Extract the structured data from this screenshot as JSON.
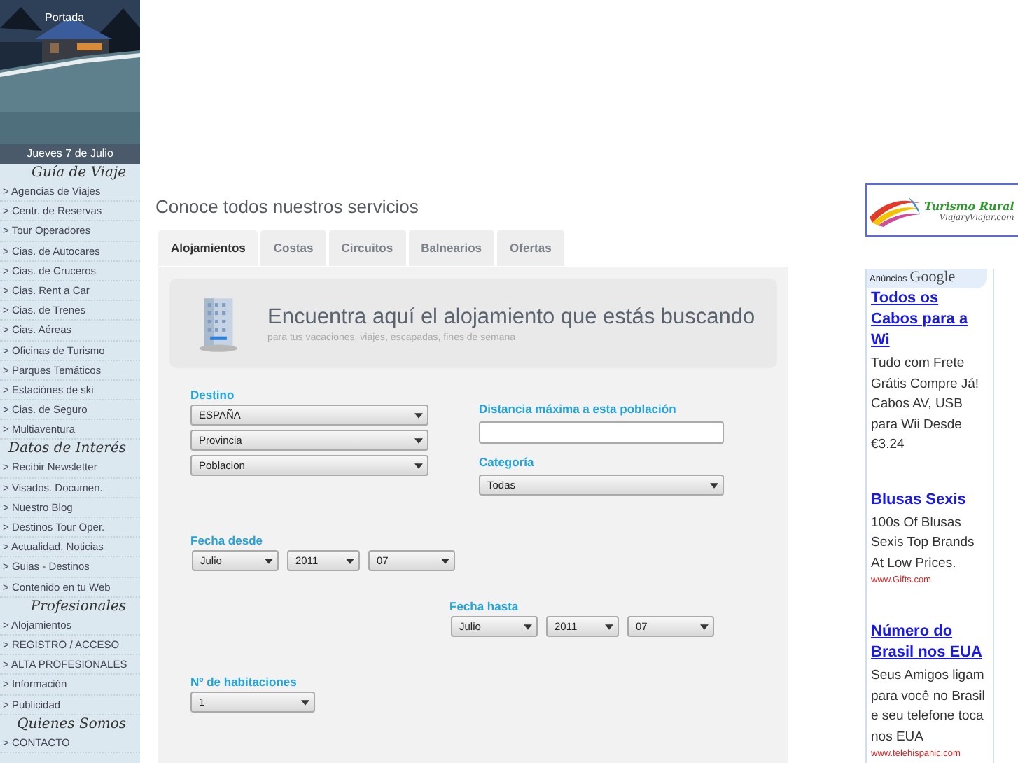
{
  "sidebar": {
    "photo_label": "Portada",
    "date": "Jueves 7 de Julio",
    "sections": [
      {
        "title": "Guía de Viaje",
        "items": [
          "> Agencias de Viajes",
          "> Centr. de Reservas",
          "> Tour Operadores",
          "> Cias. de Autocares",
          "> Cias. de Cruceros",
          "> Cias. Rent a Car",
          "> Cias. de Trenes",
          "> Cias. Aéreas",
          "> Oficinas de Turismo",
          "> Parques Temáticos",
          "> Estaciónes de ski",
          "> Cias. de Seguro",
          "> Multiaventura"
        ]
      },
      {
        "title": "Datos de Interés",
        "items": [
          "> Recibir Newsletter",
          "> Visados. Documen.",
          "> Nuestro Blog",
          "> Destinos Tour Oper.",
          "> Actualidad. Noticias",
          "> Guias - Destinos",
          "> Contenido en tu Web"
        ]
      },
      {
        "title": "Profesionales",
        "items": [
          "> Alojamientos",
          "> REGISTRO / ACCESO",
          "> ALTA PROFESIONALES",
          "> Información",
          "> Publicidad"
        ]
      },
      {
        "title": "Quienes Somos",
        "items": [
          "> CONTACTO"
        ]
      }
    ]
  },
  "main": {
    "title": "Conoce todos nuestros servicios",
    "tabs": [
      {
        "label": "Alojamientos",
        "selected": true
      },
      {
        "label": "Costas",
        "selected": false
      },
      {
        "label": "Circuitos",
        "selected": false
      },
      {
        "label": "Balnearios",
        "selected": false
      },
      {
        "label": "Ofertas",
        "selected": false
      }
    ],
    "banner": {
      "heading": "Encuentra aquí el alojamiento que estás buscando",
      "subheading": "para tus vacaciones, viajes, escapadas, fines de semana"
    },
    "form": {
      "destino_label": "Destino",
      "destino": [
        "ESPAÑA",
        "Provincia",
        "Poblacion"
      ],
      "distance_label": "Distancia máxima a esta población",
      "category_label": "Categoría",
      "category": "Todas",
      "from_label": "Fecha desde",
      "from": [
        "Julio",
        "2011",
        "07"
      ],
      "to_label": "Fecha hasta",
      "to": [
        "Julio",
        "2011",
        "07"
      ],
      "rooms_label": "Nº de habitaciones",
      "rooms": "1"
    }
  },
  "right": {
    "logo": {
      "title": "Turismo Rural",
      "site": "ViajaryViajar.com"
    },
    "ads_header": {
      "label": "Anúncios",
      "brand": "Google"
    },
    "ads": [
      {
        "title": "Todos os Cabos para a Wi",
        "underlined": true,
        "body": "Tudo com Frete Grátis Compre Já! Cabos AV, USB para Wii Desde €3.24"
      },
      {
        "title": "Blusas Sexis",
        "underlined": false,
        "body": "100s Of Blusas Sexis Top Brands At Low Prices.",
        "url": "www.Gifts.com"
      },
      {
        "title": "Número do Brasil nos EUA",
        "underlined": true,
        "body": "Seus Amigos ligam para você no Brasil e seu telefone toca nos EUA",
        "url": "www.telehispanic.com"
      }
    ]
  }
}
